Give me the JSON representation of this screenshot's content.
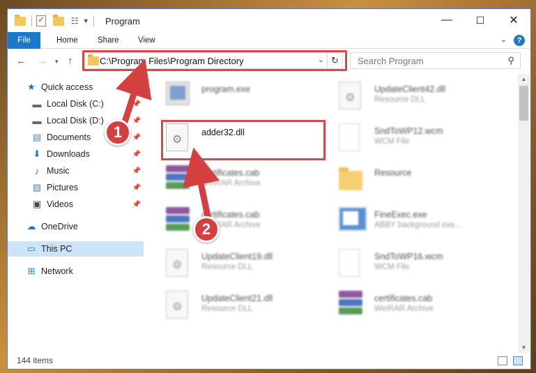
{
  "window": {
    "title": "Program",
    "controls": {
      "minimize": "—",
      "maximize": "☐",
      "close": "✕"
    }
  },
  "ribbon": {
    "tabs": [
      "File",
      "Home",
      "Share",
      "View"
    ],
    "help": "?"
  },
  "nav": {
    "address": "C:\\Program Files\\Program Directory",
    "search_placeholder": "Search Program"
  },
  "sidebar": {
    "items": [
      {
        "label": "Quick access",
        "icon": "star-icon",
        "pinned": false
      },
      {
        "label": "Local Disk (C:)",
        "icon": "drive-icon",
        "pinned": true
      },
      {
        "label": "Local Disk (D:)",
        "icon": "drive-icon",
        "pinned": true
      },
      {
        "label": "Documents",
        "icon": "documents-icon",
        "pinned": true
      },
      {
        "label": "Downloads",
        "icon": "download-icon",
        "pinned": true
      },
      {
        "label": "Music",
        "icon": "music-icon",
        "pinned": true
      },
      {
        "label": "Pictures",
        "icon": "pictures-icon",
        "pinned": true
      },
      {
        "label": "Videos",
        "icon": "videos-icon",
        "pinned": true
      },
      {
        "label": "OneDrive",
        "icon": "cloud-icon",
        "pinned": false
      },
      {
        "label": "This PC",
        "icon": "computer-icon",
        "pinned": false
      },
      {
        "label": "Network",
        "icon": "network-icon",
        "pinned": false
      }
    ]
  },
  "files": [
    {
      "name": "program.exe",
      "type": "",
      "icon": "exe-icon"
    },
    {
      "name": "UpdateClient42.dll",
      "type": "Resource DLL",
      "icon": "dll-icon"
    },
    {
      "name": "adder32.dll",
      "type": "",
      "icon": "dll-icon"
    },
    {
      "name": "SndToWP12.wcm",
      "type": "WCM File",
      "icon": "document-icon"
    },
    {
      "name": "certificates.cab",
      "type": "WinRAR Archive",
      "icon": "winrar-icon"
    },
    {
      "name": "Resource",
      "type": "",
      "icon": "folder-icon"
    },
    {
      "name": "certificates.cab",
      "type": "WinRAR Archive",
      "icon": "winrar-icon"
    },
    {
      "name": "FineExec.exe",
      "type": "ABBY background exe...",
      "icon": "app-icon"
    },
    {
      "name": "UpdateClient19.dll",
      "type": "Resource DLL",
      "icon": "dll-icon"
    },
    {
      "name": "SndToWP16.wcm",
      "type": "WCM File",
      "icon": "document-icon"
    },
    {
      "name": "UpdateClient21.dll",
      "type": "Resource DLL",
      "icon": "dll-icon"
    },
    {
      "name": "certificates.cab",
      "type": "WinRAR Archive",
      "icon": "winrar-icon"
    }
  ],
  "status": {
    "items": "144 items"
  },
  "annotations": {
    "step1": "1",
    "step2": "2",
    "color": "#d43f3f"
  }
}
